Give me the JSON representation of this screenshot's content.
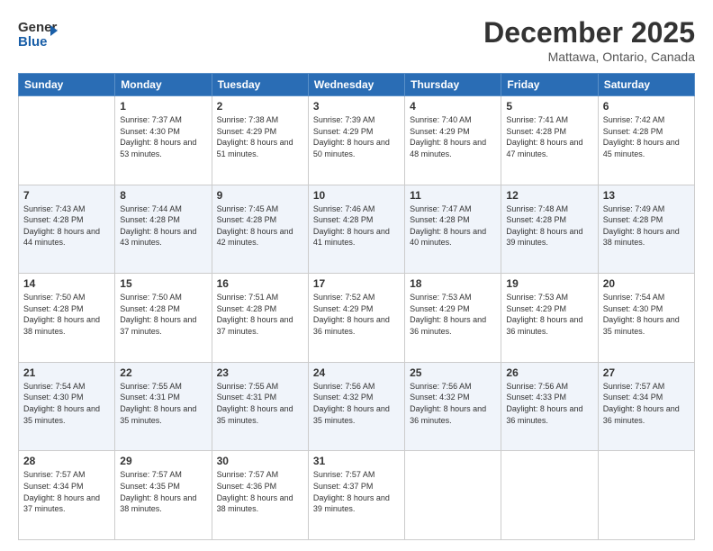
{
  "header": {
    "logo_line1": "General",
    "logo_line2": "Blue",
    "month": "December 2025",
    "location": "Mattawa, Ontario, Canada"
  },
  "weekdays": [
    "Sunday",
    "Monday",
    "Tuesday",
    "Wednesday",
    "Thursday",
    "Friday",
    "Saturday"
  ],
  "weeks": [
    [
      {
        "day": "",
        "sunrise": "",
        "sunset": "",
        "daylight": ""
      },
      {
        "day": "1",
        "sunrise": "Sunrise: 7:37 AM",
        "sunset": "Sunset: 4:30 PM",
        "daylight": "Daylight: 8 hours and 53 minutes."
      },
      {
        "day": "2",
        "sunrise": "Sunrise: 7:38 AM",
        "sunset": "Sunset: 4:29 PM",
        "daylight": "Daylight: 8 hours and 51 minutes."
      },
      {
        "day": "3",
        "sunrise": "Sunrise: 7:39 AM",
        "sunset": "Sunset: 4:29 PM",
        "daylight": "Daylight: 8 hours and 50 minutes."
      },
      {
        "day": "4",
        "sunrise": "Sunrise: 7:40 AM",
        "sunset": "Sunset: 4:29 PM",
        "daylight": "Daylight: 8 hours and 48 minutes."
      },
      {
        "day": "5",
        "sunrise": "Sunrise: 7:41 AM",
        "sunset": "Sunset: 4:28 PM",
        "daylight": "Daylight: 8 hours and 47 minutes."
      },
      {
        "day": "6",
        "sunrise": "Sunrise: 7:42 AM",
        "sunset": "Sunset: 4:28 PM",
        "daylight": "Daylight: 8 hours and 45 minutes."
      }
    ],
    [
      {
        "day": "7",
        "sunrise": "Sunrise: 7:43 AM",
        "sunset": "Sunset: 4:28 PM",
        "daylight": "Daylight: 8 hours and 44 minutes."
      },
      {
        "day": "8",
        "sunrise": "Sunrise: 7:44 AM",
        "sunset": "Sunset: 4:28 PM",
        "daylight": "Daylight: 8 hours and 43 minutes."
      },
      {
        "day": "9",
        "sunrise": "Sunrise: 7:45 AM",
        "sunset": "Sunset: 4:28 PM",
        "daylight": "Daylight: 8 hours and 42 minutes."
      },
      {
        "day": "10",
        "sunrise": "Sunrise: 7:46 AM",
        "sunset": "Sunset: 4:28 PM",
        "daylight": "Daylight: 8 hours and 41 minutes."
      },
      {
        "day": "11",
        "sunrise": "Sunrise: 7:47 AM",
        "sunset": "Sunset: 4:28 PM",
        "daylight": "Daylight: 8 hours and 40 minutes."
      },
      {
        "day": "12",
        "sunrise": "Sunrise: 7:48 AM",
        "sunset": "Sunset: 4:28 PM",
        "daylight": "Daylight: 8 hours and 39 minutes."
      },
      {
        "day": "13",
        "sunrise": "Sunrise: 7:49 AM",
        "sunset": "Sunset: 4:28 PM",
        "daylight": "Daylight: 8 hours and 38 minutes."
      }
    ],
    [
      {
        "day": "14",
        "sunrise": "Sunrise: 7:50 AM",
        "sunset": "Sunset: 4:28 PM",
        "daylight": "Daylight: 8 hours and 38 minutes."
      },
      {
        "day": "15",
        "sunrise": "Sunrise: 7:50 AM",
        "sunset": "Sunset: 4:28 PM",
        "daylight": "Daylight: 8 hours and 37 minutes."
      },
      {
        "day": "16",
        "sunrise": "Sunrise: 7:51 AM",
        "sunset": "Sunset: 4:28 PM",
        "daylight": "Daylight: 8 hours and 37 minutes."
      },
      {
        "day": "17",
        "sunrise": "Sunrise: 7:52 AM",
        "sunset": "Sunset: 4:29 PM",
        "daylight": "Daylight: 8 hours and 36 minutes."
      },
      {
        "day": "18",
        "sunrise": "Sunrise: 7:53 AM",
        "sunset": "Sunset: 4:29 PM",
        "daylight": "Daylight: 8 hours and 36 minutes."
      },
      {
        "day": "19",
        "sunrise": "Sunrise: 7:53 AM",
        "sunset": "Sunset: 4:29 PM",
        "daylight": "Daylight: 8 hours and 36 minutes."
      },
      {
        "day": "20",
        "sunrise": "Sunrise: 7:54 AM",
        "sunset": "Sunset: 4:30 PM",
        "daylight": "Daylight: 8 hours and 35 minutes."
      }
    ],
    [
      {
        "day": "21",
        "sunrise": "Sunrise: 7:54 AM",
        "sunset": "Sunset: 4:30 PM",
        "daylight": "Daylight: 8 hours and 35 minutes."
      },
      {
        "day": "22",
        "sunrise": "Sunrise: 7:55 AM",
        "sunset": "Sunset: 4:31 PM",
        "daylight": "Daylight: 8 hours and 35 minutes."
      },
      {
        "day": "23",
        "sunrise": "Sunrise: 7:55 AM",
        "sunset": "Sunset: 4:31 PM",
        "daylight": "Daylight: 8 hours and 35 minutes."
      },
      {
        "day": "24",
        "sunrise": "Sunrise: 7:56 AM",
        "sunset": "Sunset: 4:32 PM",
        "daylight": "Daylight: 8 hours and 35 minutes."
      },
      {
        "day": "25",
        "sunrise": "Sunrise: 7:56 AM",
        "sunset": "Sunset: 4:32 PM",
        "daylight": "Daylight: 8 hours and 36 minutes."
      },
      {
        "day": "26",
        "sunrise": "Sunrise: 7:56 AM",
        "sunset": "Sunset: 4:33 PM",
        "daylight": "Daylight: 8 hours and 36 minutes."
      },
      {
        "day": "27",
        "sunrise": "Sunrise: 7:57 AM",
        "sunset": "Sunset: 4:34 PM",
        "daylight": "Daylight: 8 hours and 36 minutes."
      }
    ],
    [
      {
        "day": "28",
        "sunrise": "Sunrise: 7:57 AM",
        "sunset": "Sunset: 4:34 PM",
        "daylight": "Daylight: 8 hours and 37 minutes."
      },
      {
        "day": "29",
        "sunrise": "Sunrise: 7:57 AM",
        "sunset": "Sunset: 4:35 PM",
        "daylight": "Daylight: 8 hours and 38 minutes."
      },
      {
        "day": "30",
        "sunrise": "Sunrise: 7:57 AM",
        "sunset": "Sunset: 4:36 PM",
        "daylight": "Daylight: 8 hours and 38 minutes."
      },
      {
        "day": "31",
        "sunrise": "Sunrise: 7:57 AM",
        "sunset": "Sunset: 4:37 PM",
        "daylight": "Daylight: 8 hours and 39 minutes."
      },
      {
        "day": "",
        "sunrise": "",
        "sunset": "",
        "daylight": ""
      },
      {
        "day": "",
        "sunrise": "",
        "sunset": "",
        "daylight": ""
      },
      {
        "day": "",
        "sunrise": "",
        "sunset": "",
        "daylight": ""
      }
    ]
  ]
}
